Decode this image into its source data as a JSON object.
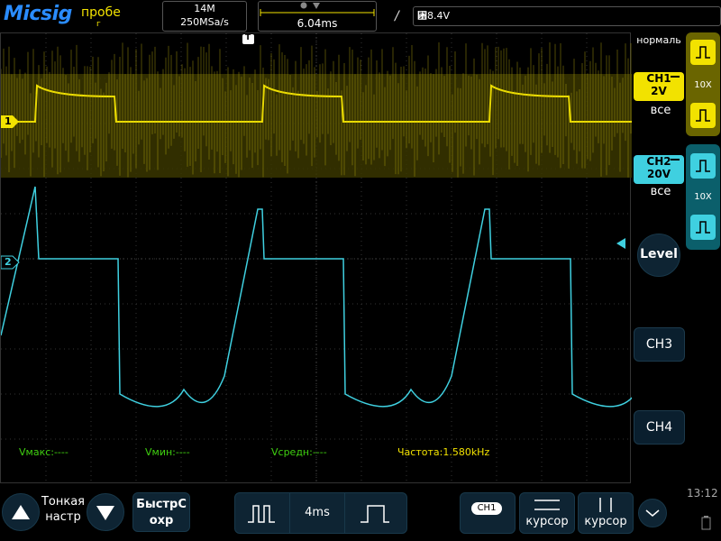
{
  "header": {
    "logo": "Micsig",
    "probe_label": "пробе",
    "probe_sub": "г",
    "memory_depth": "14M",
    "sample_rate": "250MSa/s",
    "timebase_position": "6.04ms",
    "trigger_level": "␸8.4V",
    "trigger_marker": "T"
  },
  "measurements": {
    "vmax": "Vмакс:----",
    "vmin": "Vмин:----",
    "vavg": "Vсредн:----",
    "freq": "Частота:1.580kHz"
  },
  "channels": {
    "ch1_marker": "1",
    "ch2_marker": "2"
  },
  "right_panel": {
    "trigger_mode": "нормаль",
    "ch1_label": "CH1",
    "ch1_scale": "2V",
    "ch1_coupling": "все",
    "ch1_probe": "10X",
    "ch2_label": "CH2",
    "ch2_scale": "20V",
    "ch2_coupling": "все",
    "ch2_probe": "10X",
    "level_label": "Level",
    "ch3_label": "CH3",
    "ch4_label": "CH4",
    "colors": {
      "ch1": "#f2e200",
      "ch2": "#3fd0e0"
    }
  },
  "bottom_bar": {
    "fine_label": "Тонкая настр",
    "quick_save_label": "БыстрС охр",
    "timebase": "4ms",
    "ch1_tag": "CH1",
    "cursor1_label": "курсор",
    "cursor2_label": "курсор",
    "clock": "13:12"
  }
}
